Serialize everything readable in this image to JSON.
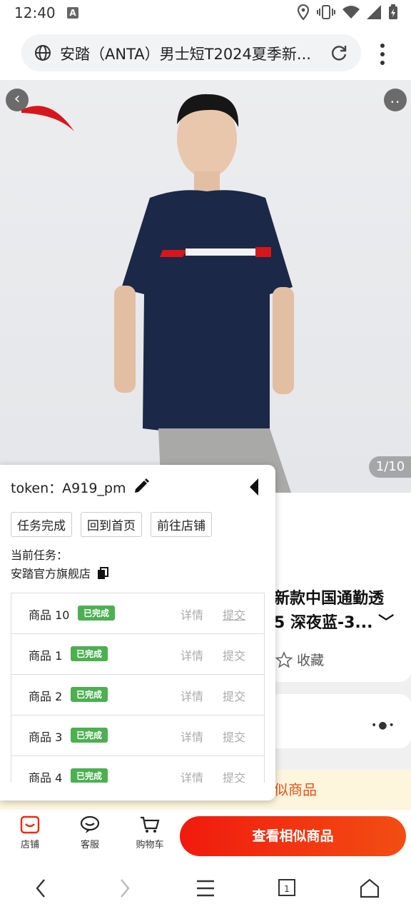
{
  "status_bar": {
    "time": "12:40"
  },
  "browser": {
    "page_title": "安踏（ANTA）男士短T2024夏季新..."
  },
  "hero": {
    "image_counter": "1/10"
  },
  "product": {
    "title_line1": "新款中国通勤透",
    "title_line2": "5 深夜蓝-3...",
    "favorite_label": "收藏",
    "similar_banner": "似商品"
  },
  "panel": {
    "token_label": "token：",
    "token_value": "A919_pm",
    "buttons": [
      "任务完成",
      "回到首页",
      "前往店铺"
    ],
    "current_task_label": "当前任务：",
    "current_task_value": "安踏官方旗舰店",
    "items": [
      {
        "name": "商品 10",
        "status": "已完成",
        "detail": "详情",
        "submit": "提交",
        "submit_underlined": true
      },
      {
        "name": "商品 1",
        "status": "已完成",
        "detail": "详情",
        "submit": "提交",
        "submit_underlined": false
      },
      {
        "name": "商品 2",
        "status": "已完成",
        "detail": "详情",
        "submit": "提交",
        "submit_underlined": false
      },
      {
        "name": "商品 3",
        "status": "已完成",
        "detail": "详情",
        "submit": "提交",
        "submit_underlined": false
      },
      {
        "name": "商品 4",
        "status": "已完成",
        "detail": "详情",
        "submit": "提交",
        "submit_underlined": false
      }
    ]
  },
  "bottom_bar": {
    "store": "店铺",
    "service": "客服",
    "cart": "购物车",
    "cta": "查看相似商品"
  },
  "colors": {
    "accent": "#f11a0e",
    "badge": "#4caf50",
    "banner_text": "#e8521a"
  }
}
